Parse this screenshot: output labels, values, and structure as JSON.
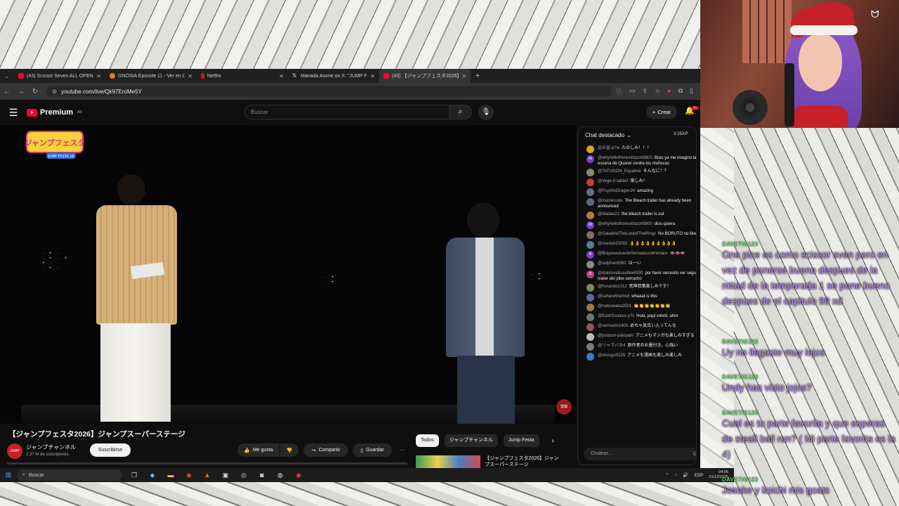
{
  "browser": {
    "tabs": [
      {
        "label": "(43) Scissor Seven ALL OPENI...",
        "color": "#ff0033"
      },
      {
        "label": "GNOSIA Episode 11 - Ver en Cr...",
        "color": "#f47521"
      },
      {
        "label": "Netflix",
        "color": "#e50914"
      },
      {
        "label": "Manada Anime on X: \"JUMP FE...",
        "color": "#ffffff"
      },
      {
        "label": "(43) 【ジャンプフェスタ2026】ジャンプ...",
        "color": "#ff0033"
      }
    ],
    "url": "youtube.com/live/Qk97EroMe5Y"
  },
  "youtube": {
    "logo": "Premium",
    "logo_sup": "AR",
    "search_placeholder": "Buscar",
    "create_label": "Crear",
    "notif_badge": "9+",
    "video_title": "【ジャンプフェスタ2026】ジャンプスーパーステージ",
    "channel_name": "ジャンプチャンネル",
    "channel_subs": "2,37 M de suscriptores",
    "subscribe_label": "Suscribirse",
    "like_label": "Me gusta",
    "share_label": "Compartir",
    "save_label": "Guardar",
    "chips": [
      "Todos",
      "ジャンプチャンネル",
      "Jump Festa"
    ],
    "rec_title": "【ジャンプフェスタ2026】ジャンプスーパーステージ",
    "video_logo": "ジャンプフェスタ",
    "video_logo_sub": "JUMP FESTA 26",
    "video_badge": "登録"
  },
  "chat": {
    "header": "Chat destacado",
    "xp": "25XP",
    "input_placeholder": "Chatear...",
    "messages": [
      {
        "user": "@お盆-p7w",
        "text": "たのしみ！！！",
        "av": "",
        "color": "#d9a22a"
      },
      {
        "user": "@whyhellothereoldsport8800",
        "text": "Broo ya me imagino la escena de Quanxi contra los muñecos",
        "av": "W",
        "color": "#7b3fc4"
      },
      {
        "user": "@TATUGON_Equalme",
        "text": "そんなに！？",
        "av": "",
        "color": "#8a8a6a"
      },
      {
        "user": "@Vege-0-table3",
        "text": "楽しみ！",
        "av": "",
        "color": "#c43f3f"
      },
      {
        "user": "@PsychicDragon24",
        "text": "amazing",
        "av": "",
        "color": "#6a6a8a"
      },
      {
        "user": "@masteruwu",
        "text": "The Bleach trailer has already been announced",
        "av": "",
        "color": "#5a6a7a"
      },
      {
        "user": "@Madao21",
        "text": "the bleach trailer is out",
        "av": "",
        "color": "#b07a4a"
      },
      {
        "user": "@whyhellothereoldsport8800",
        "text": "dios quiera",
        "av": "W",
        "color": "#7b3fc4"
      },
      {
        "user": "@GaladrielTheLordofTheRings",
        "text": "No BORUTO no like",
        "av": "",
        "color": "#8a6a5a"
      },
      {
        "user": "@manish20093",
        "text": "👌👌👌👌👌👌👌👌👌",
        "av": "",
        "color": "#5a7a9a"
      },
      {
        "user": "@BrayaneduardoSerradascolmenare",
        "text": "👄👄👄",
        "av": "B",
        "color": "#7b3fc4"
      },
      {
        "user": "@ladphan8380",
        "text": "はーい",
        "av": "",
        "color": "#8a8a8a"
      },
      {
        "user": "@dokiruvabsauflex6930",
        "text": "por favor necesito ver segundo trailer del pibe serrucho",
        "av": "D",
        "color": "#c43f7b"
      },
      {
        "user": "@horando1012",
        "text": "死神双葉楽しみです！",
        "av": "",
        "color": "#7a8a5a"
      },
      {
        "user": "@LehanAhamed",
        "text": "whaaat is this",
        "av": "",
        "color": "#5a6a9a"
      },
      {
        "user": "@natsuwaka2501",
        "text": "👏👏👏👏👏👏👏",
        "av": "",
        "color": "#9a7a4a"
      },
      {
        "user": "@EzekSouless-y7s",
        "text": "Hola, papi volvió, ahre",
        "av": "",
        "color": "#6a7a6a"
      },
      {
        "user": "@serruunn1400",
        "text": "めちゃ気合い入ってんな",
        "av": "",
        "color": "#8a5a5a"
      },
      {
        "user": "@ponpon-painpain",
        "text": "アニメもマンガも楽しみすぎる",
        "av": "",
        "color": "#bbbbbb"
      },
      {
        "user": "@リャマバカ4",
        "text": "原作者のお墨付き。心強い",
        "av": "",
        "color": "#7a7a7a"
      },
      {
        "user": "@shougo0226",
        "text": "アニメも漫画も楽しみ楽しみ",
        "av": "",
        "color": "#3f7bc4"
      }
    ]
  },
  "taskbar": {
    "search_label": "Buscar",
    "lang": "ESP",
    "time": "04:06",
    "date": "21/12/2025"
  },
  "overlay": [
    {
      "user": "DAVETIG123",
      "text": "One pice es como scissor sven pero en vez de ponerse bueno despues de la mitad de la temporada 1 se pone bueno despues de el capitulo 99 xd"
    },
    {
      "user": "DAVETIG123",
      "text": "Uy no llegaste muy lejos"
    },
    {
      "user": "DAVETIG123",
      "text": "Undy has visto jojos?"
    },
    {
      "user": "DAVETIG123",
      "text": "Cual es tu parte favorita y que esperas de steall ball run? ( Mi parte favorita es la 4)"
    },
    {
      "user": "DAVETIG123",
      "text": "Josuke y koichi mis goats"
    }
  ]
}
